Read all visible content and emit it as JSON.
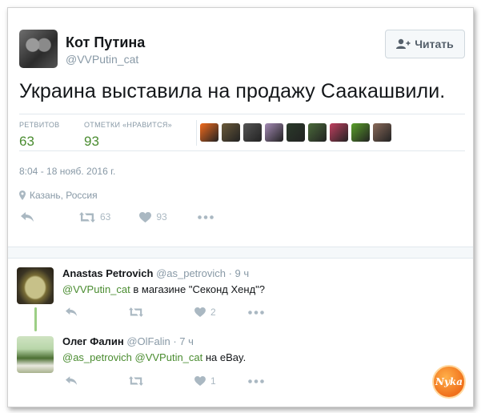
{
  "tweet": {
    "author_name": "Кот Путина",
    "author_handle": "@VVPutin_cat",
    "follow_label": "Читать",
    "text": "Украина выставила на продажу Саакашвили.",
    "retweets_label": "РЕТВИТОВ",
    "retweets": "63",
    "likes_label": "ОТМЕТКИ «НРАВИТСЯ»",
    "likes": "93",
    "timestamp": "8:04 - 18 нояб. 2016 г.",
    "location": "Казань, Россия",
    "action_retweet_count": "63",
    "action_like_count": "93",
    "likers": [
      "#f26b1d",
      "#6b5a3a",
      "#555555",
      "#a48bb5",
      "#2a3a2a",
      "#4a6a3a",
      "#c04060",
      "#5aa02a",
      "#8a6a5a"
    ]
  },
  "replies": [
    {
      "name": "Anastas Petrovich",
      "handle": "@as_petrovich",
      "time": "· 9 ч",
      "mention": "@VVPutin_cat",
      "text": " в магазине \"Секонд Хенд\"?",
      "like_count": "2"
    },
    {
      "name": "Олег Фалин",
      "handle": "@OlFalin",
      "time": "· 7 ч",
      "mention": "@as_petrovich @VVPutin_cat",
      "text": " на eBay.",
      "like_count": "1"
    }
  ],
  "watermark_text": "Nyka",
  "icons": [
    "follow-person-icon",
    "reply-icon",
    "retweet-icon",
    "heart-icon",
    "more-icon",
    "location-pin-icon"
  ],
  "accent_color": "#4a8c30"
}
